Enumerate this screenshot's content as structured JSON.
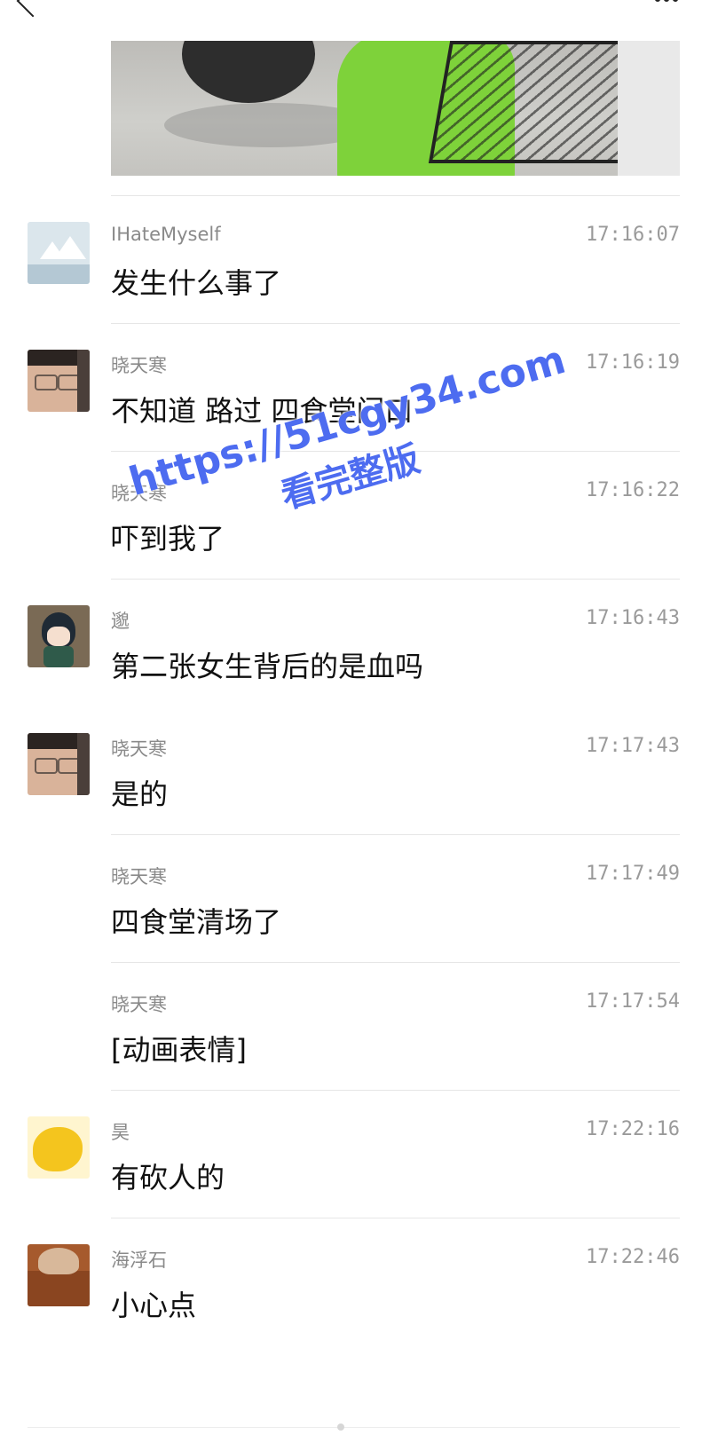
{
  "header": {
    "back_icon": "chevron-left-icon",
    "more_icon": "more-dots-icon"
  },
  "messages": [
    {
      "sender": "IHateMyself",
      "time": "17:16:07",
      "text": "发生什么事了",
      "avatar": "landscape-placeholder"
    },
    {
      "sender": "晓天寒",
      "time": "17:16:19",
      "text": "不知道 路过 四食堂门口",
      "avatar": "face-photo"
    },
    {
      "sender": "晓天寒",
      "time": "17:16:22",
      "text": "吓到我了",
      "avatar": ""
    },
    {
      "sender": "邈",
      "time": "17:16:43",
      "text": "第二张女生背后的是血吗",
      "avatar": "anime-character"
    },
    {
      "sender": "晓天寒",
      "time": "17:17:43",
      "text": "是的",
      "avatar": "face-photo"
    },
    {
      "sender": "晓天寒",
      "time": "17:17:49",
      "text": "四食堂清场了",
      "avatar": ""
    },
    {
      "sender": "晓天寒",
      "time": "17:17:54",
      "text": "[动画表情]",
      "avatar": ""
    },
    {
      "sender": "昊",
      "time": "17:22:16",
      "text": "有砍人的",
      "avatar": "yellow-cartoon"
    },
    {
      "sender": "海浮石",
      "time": "17:22:46",
      "text": "小心点",
      "avatar": "cat-photo"
    }
  ],
  "watermark": {
    "url": "https://51cgy34.com",
    "subtitle": "看完整版",
    "color": "#4d6cf0"
  }
}
